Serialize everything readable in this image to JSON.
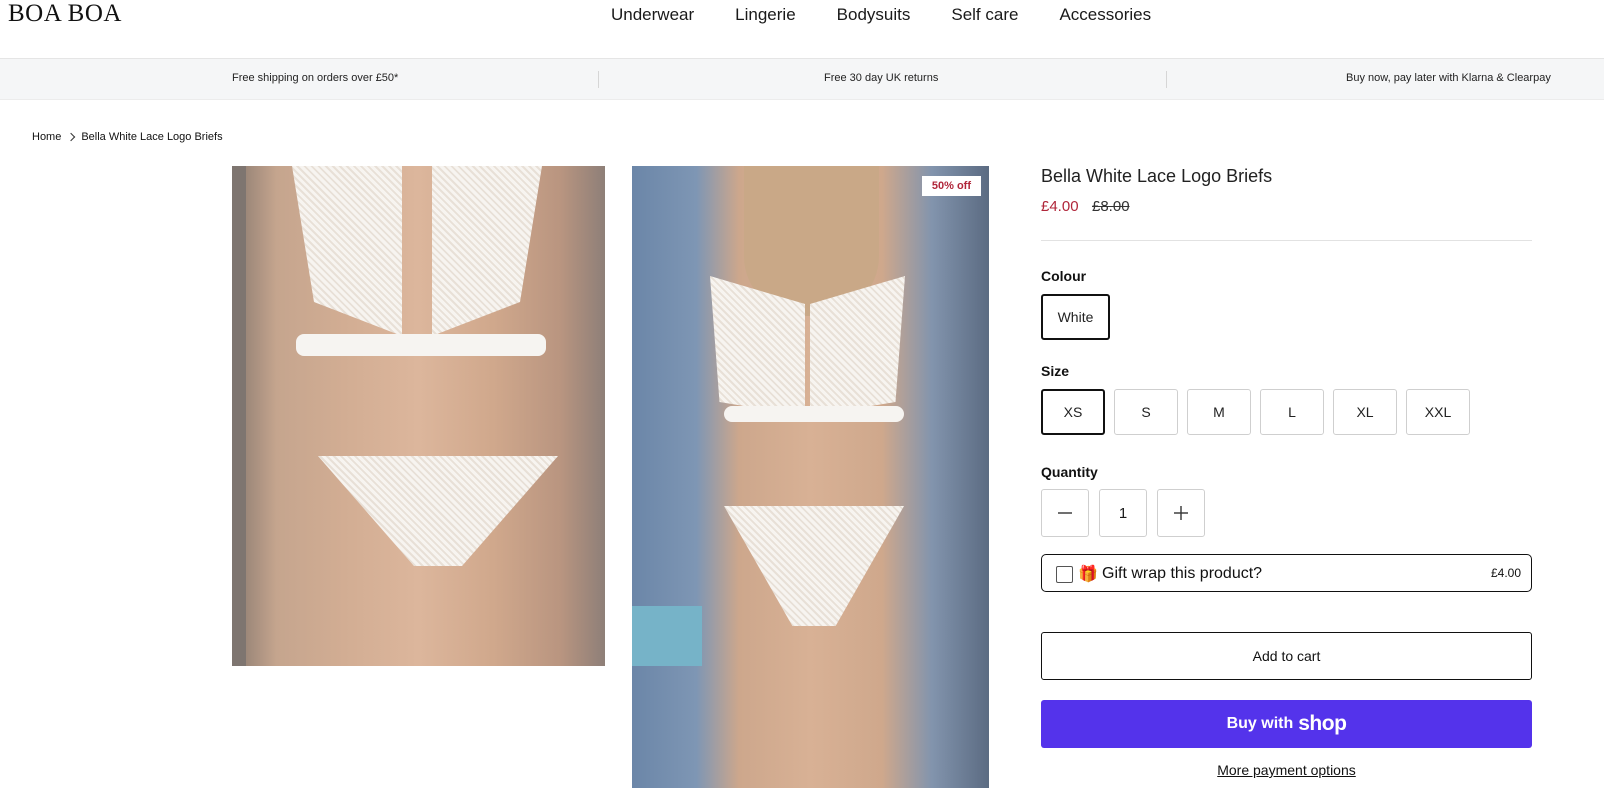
{
  "header": {
    "logo": "BOA BOA",
    "nav": [
      "Underwear",
      "Lingerie",
      "Bodysuits",
      "Self care",
      "Accessories"
    ]
  },
  "announcements": [
    "Free shipping on orders over £50*",
    "Free 30 day UK returns",
    "Buy now, pay later with Klarna & Clearpay"
  ],
  "breadcrumb": {
    "home": "Home",
    "current": "Bella White Lace Logo Briefs"
  },
  "gallery": {
    "badge": "50% off"
  },
  "product": {
    "title": "Bella White Lace Logo Briefs",
    "price": "£4.00",
    "compare_price": "£8.00",
    "colour_label": "Colour",
    "colours": [
      "White"
    ],
    "selected_colour": "White",
    "size_label": "Size",
    "sizes": [
      "XS",
      "S",
      "M",
      "L",
      "XL",
      "XXL"
    ],
    "selected_size": "XS",
    "quantity_label": "Quantity",
    "quantity": "1",
    "decrease_icon": "minus-icon",
    "increase_icon": "plus-icon",
    "gift_wrap": {
      "emoji": "🎁",
      "label": "Gift wrap this product?",
      "price": "£4.00",
      "checked": false
    },
    "add_to_cart": "Add to cart",
    "buy_with": "Buy with",
    "buy_brand": "shop",
    "more_payment": "More payment options"
  },
  "colors": {
    "sale_red": "#b0263a",
    "shop_purple": "#5433eb",
    "announce_bg": "#f5f6f7"
  }
}
